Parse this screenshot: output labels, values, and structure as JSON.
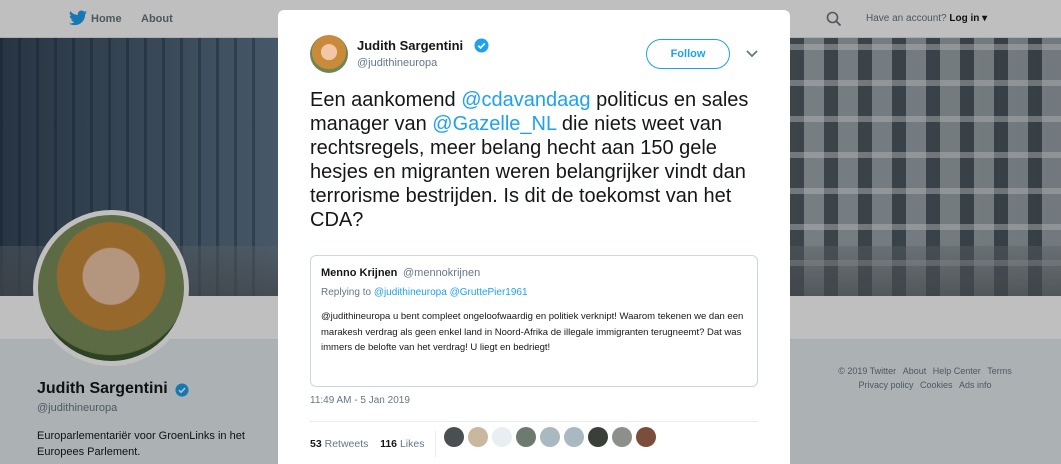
{
  "nav": {
    "home": "Home",
    "about": "About",
    "account_prompt": "Have an account?",
    "login": "Log in"
  },
  "profile": {
    "name": "Judith Sargentini",
    "handle": "@judithineuropa",
    "bio": "Europarlementariër voor GroenLinks in het Europees Parlement."
  },
  "footer": {
    "links": [
      "© 2019 Twitter",
      "About",
      "Help Center",
      "Terms",
      "Privacy policy",
      "Cookies",
      "Ads info"
    ]
  },
  "tweet": {
    "author_name": "Judith Sargentini",
    "author_handle": "@judithineuropa",
    "follow_label": "Follow",
    "text_parts": [
      {
        "t": "Een aankomend ",
        "mention": false
      },
      {
        "t": "@cdavandaag",
        "mention": true
      },
      {
        "t": " politicus en sales manager van ",
        "mention": false
      },
      {
        "t": "@Gazelle_NL",
        "mention": true
      },
      {
        "t": " die niets weet van rechtsregels, meer belang hecht aan 150 gele hesjes en migranten weren belangrijker vindt dan terrorisme bestrijden. Is dit de toekomst van het CDA?",
        "mention": false
      }
    ],
    "quote": {
      "name": "Menno Krijnen",
      "handle": "@mennokrijnen",
      "replying_prefix": "Replying to",
      "replying_to": "@judithineuropa @GruttePier1961",
      "text": "@judithineuropa u bent compleet ongeloofwaardig en politiek verknipt! Waarom tekenen we dan een marakesh verdrag als geen enkel land in Noord-Afrika de illegale immigranten terugneemt? Dat was immers de belofte van het verdrag! U liegt en bedriegt!"
    },
    "timestamp": "11:49 AM - 5 Jan 2019",
    "retweets_count": "53",
    "retweets_label": "Retweets",
    "likes_count": "116",
    "likes_label": "Likes"
  },
  "colors": {
    "accent": "#1da1f2",
    "text": "#14171a",
    "muted": "#657786"
  }
}
